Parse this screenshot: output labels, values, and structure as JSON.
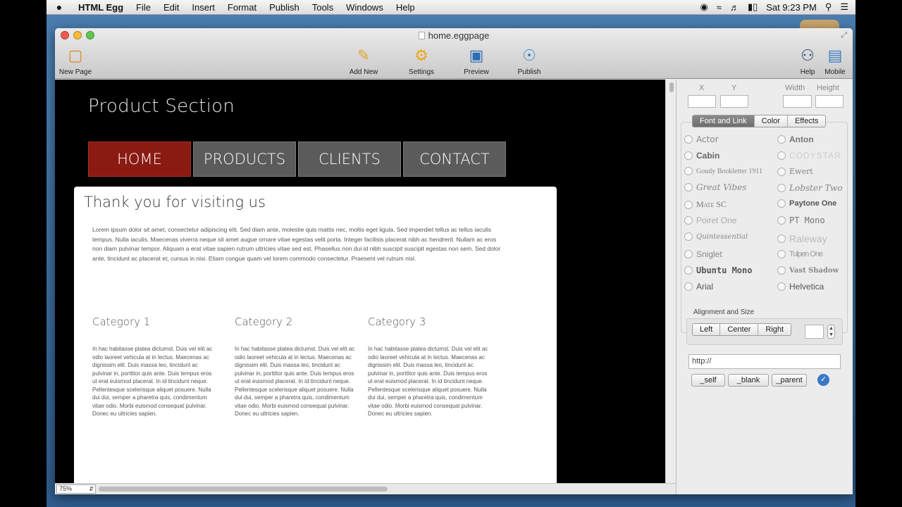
{
  "menubar": {
    "app": "HTML Egg",
    "items": [
      "File",
      "Edit",
      "Insert",
      "Format",
      "Publish",
      "Tools",
      "Windows",
      "Help"
    ],
    "clock": "Sat 9:23 PM"
  },
  "window": {
    "title": "home.eggpage",
    "toolbar": {
      "new_page": "New Page",
      "add_new": "Add New",
      "settings": "Settings",
      "preview": "Preview",
      "publish": "Publish",
      "help": "Help",
      "mobile": "Mobile"
    }
  },
  "canvas": {
    "page_title": "Product Section",
    "nav": [
      "HOME",
      "PRODUCTS",
      "CLIENTS",
      "CONTACT"
    ],
    "content_title": "Thank you for visiting us",
    "lorem": "Lorem ipsum dolor sit amet, consectetur adipiscing elit. Sed diam ante, molestie quis mattis nec, mollis eget ligula. Sed imperdiet tellus ac tellus iaculis tempus. Nulla iaculis. Maecenas viverra neque sit amet augue ornare vitae egestas velit porta. Integer facilisis placerat nibh ac hendrerit. Nullam ac eros non diam pulvinar tempor. Aliquam a erat vitae sapien rutrum ultricies vitae sed est. Phasellus non dui id nibh suscipit suscipit egestas non sem. Sed dolor ante, tincidunt ac placerat et, cursus in nisi. Etiam congue quam vel lorem commodo consectetur. Praesent vel rutrum nisl.",
    "categories": [
      {
        "title": "Category 1",
        "text": "In hac habitasse platea dictumst. Duis vel elit ac odio laoreet vehicula at in lectus. Maecenas ac dignissim elit. Duis massa leo, tincidunt ac pulvinar in, porttitor quis ante. Duis tempus eros ut erat euismod placerat. In id tincidunt neque. Pellentesque scelerisque aliquet posuere. Nulla dui dui, semper a pharetra quis, condimentum vitae odio. Morbi euismod consequat pulvinar. Donec eu ultricies sapien."
      },
      {
        "title": "Category 2",
        "text": "In hac habitasse platea dictumst. Duis vel elit ac odio laoreet vehicula at in lectus. Maecenas ac dignissim elit. Duis massa leo, tincidunt ac pulvinar in, porttitor quis ante. Duis tempus eros ut erat euismod placerat. In id tincidunt neque. Pellentesque scelerisque aliquet posuere. Nulla dui dui, semper a pharetra quis, condimentum vitae odio. Morbi euismod consequat pulvinar. Donec eu ultricies sapien."
      },
      {
        "title": "Category 3",
        "text": "In hac habitasse platea dictumst. Duis vel elit ac odio laoreet vehicula at in lectus. Maecenas ac dignissim elit. Duis massa leo, tincidunt ac pulvinar in, porttitor quis ante. Duis tempus eros ut erat euismod placerat. In id tincidunt neque. Pellentesque scelerisque aliquet posuere. Nulla dui dui, semper a pharetra quis, condimentum vitae odio. Morbi euismod consequat pulvinar. Donec eu ultricies sapien."
      }
    ],
    "zoom": "75%"
  },
  "panel": {
    "x_label": "X",
    "y_label": "Y",
    "width_label": "Width",
    "height_label": "Height",
    "tabs": [
      "Font and Link",
      "Color",
      "Effects"
    ],
    "fonts_left": [
      "Actor",
      "Cabin",
      "Goudy Bookletter 1911",
      "Great Vibes",
      "Mate SC",
      "Poiret One",
      "Quintessential",
      "Sniglet",
      "Ubuntu Mono",
      "Arial"
    ],
    "fonts_right": [
      "Anton",
      "CODYSTAR",
      "Ewert",
      "Lobster Two",
      "Paytone One",
      "PT Mono",
      "Raleway",
      "Tulpen One",
      "Vast Shadow",
      "Helvetica"
    ],
    "alignment_label": "Alignment and Size",
    "align": [
      "Left",
      "Center",
      "Right"
    ],
    "url_value": "http://",
    "targets": [
      "_self",
      "_blank",
      "_parent"
    ]
  }
}
